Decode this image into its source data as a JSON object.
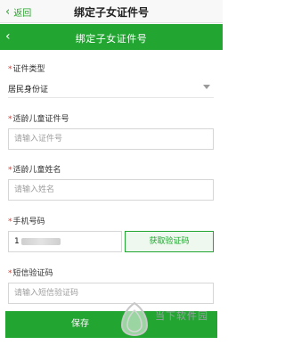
{
  "topbar": {
    "back_label": "返回",
    "title": "绑定子女证件号"
  },
  "header": {
    "title": "绑定子女证件号"
  },
  "form": {
    "id_type": {
      "label": "证件类型",
      "value": "居民身份证"
    },
    "child_id": {
      "label": "适龄儿童证件号",
      "placeholder": "请输入证件号"
    },
    "child_name": {
      "label": "适龄儿童姓名",
      "placeholder": "请输入姓名"
    },
    "phone": {
      "label": "手机号码",
      "value": "1"
    },
    "get_code_label": "获取验证码",
    "sms_code": {
      "label": "短信验证码",
      "placeholder": "请输入短信验证码"
    },
    "required_mark": "*"
  },
  "save_label": "保存",
  "watermark": {
    "name": "当下软件园"
  },
  "colors": {
    "accent": "#23a532",
    "required": "#e1372d"
  }
}
